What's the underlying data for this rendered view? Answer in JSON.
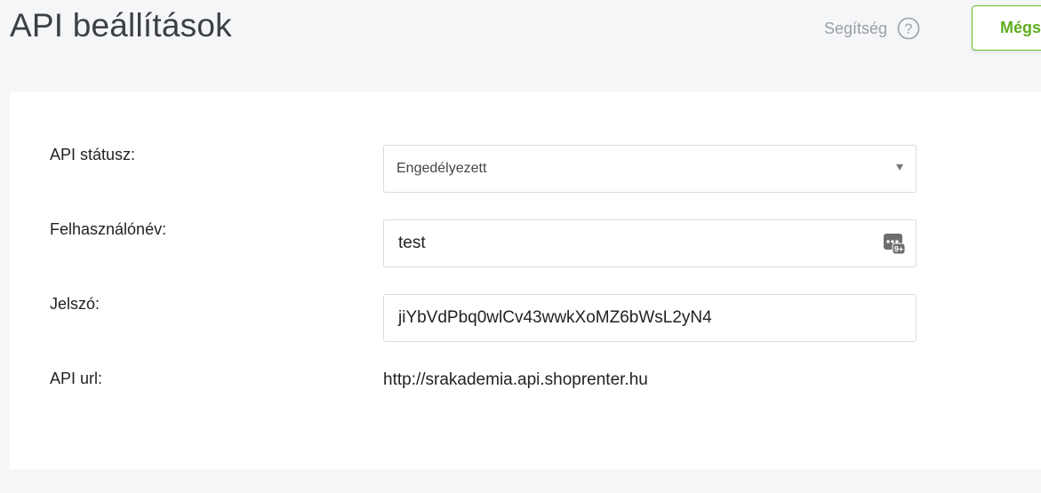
{
  "header": {
    "title": "API beállítások",
    "help_label": "Segítség",
    "help_icon": "question-circle-icon",
    "cancel_label": "Mégs"
  },
  "form": {
    "status_label": "API státusz:",
    "status_value": "Engedélyezett",
    "username_label": "Felhasználónév:",
    "username_value": "test",
    "password_label": "Jelszó:",
    "password_value": "jiYbVdPbq0wlCv43wwkXoMZ6bWsL2yN4",
    "url_label": "API url:",
    "url_value": "http://srakademia.api.shoprenter.hu"
  },
  "colors": {
    "accent": "#5fae1f",
    "background": "#f5f6f8"
  }
}
